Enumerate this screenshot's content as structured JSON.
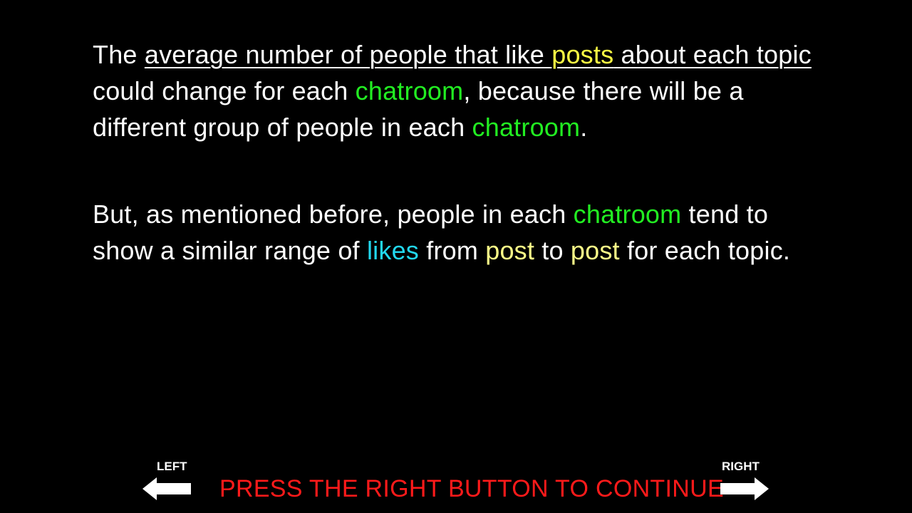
{
  "paragraph1": {
    "s1": "The ",
    "s2": "average number of people that like ",
    "s3": "posts",
    "s4": " about each topic ",
    "s5": "could change for each ",
    "s6": "chatroom",
    "s7": ", because there will be a different group of people in each ",
    "s8": "chatroom",
    "s9": "."
  },
  "paragraph2": {
    "s1": "But, as mentioned before, people in each ",
    "s2": "chatroom",
    "s3": " tend to show a similar range of ",
    "s4": "likes",
    "s5": " from ",
    "s6": "post",
    "s7": " to ",
    "s8": "post",
    "s9": " for each topic."
  },
  "navigation": {
    "left_label": "LEFT",
    "right_label": "RIGHT",
    "instruction": "PRESS THE RIGHT BUTTON TO CONTINUE",
    "left_icon": "arrow-left-icon",
    "right_icon": "arrow-right-icon"
  },
  "colors": {
    "background": "#000000",
    "text": "#ffffff",
    "chatroom": "#22ee22",
    "posts": "#ffff44",
    "likes": "#22d8ee",
    "instruction": "#ff1a1a"
  }
}
